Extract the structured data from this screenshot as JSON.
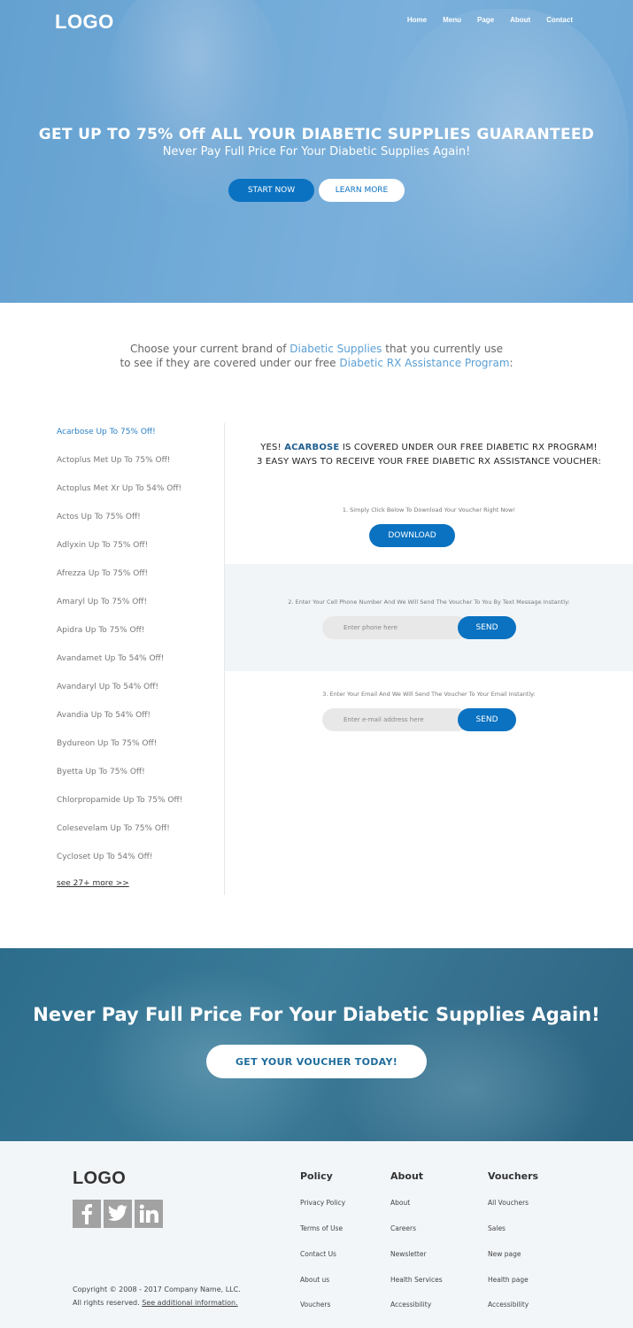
{
  "header": {
    "logo": "LOGO",
    "nav": [
      "Home",
      "Menu",
      "Page",
      "About",
      "Contact"
    ]
  },
  "hero": {
    "title": "GET UP TO 75% Off ALL YOUR DIABETIC SUPPLIES GUARANTEED",
    "subtitle": "Never Pay Full Price For Your Diabetic Supplies Again!",
    "start_label": "START NOW",
    "learn_label": "LEARN MORE"
  },
  "intro": {
    "line1_a": "Choose your current brand of ",
    "line1_hl": "Diabetic Supplies",
    "line1_b": " that you currently use",
    "line2_a": "to see if they are covered under our free ",
    "line2_hl": "Diabetic RX Assistance Program",
    "line2_b": ":"
  },
  "brands": [
    "Acarbose Up To 75% Off!",
    "Actoplus Met Up To 75% Off!",
    "Actoplus Met Xr Up To 54% Off!",
    "Actos Up To 75% Off!",
    "Adlyxin Up To 75% Off!",
    "Afrezza Up To 75% Off!",
    "Amaryl Up To 75% Off!",
    "Apidra Up To 75% Off!",
    "Avandamet Up To 54% Off!",
    "Avandaryl Up To 54% Off!",
    "Avandia Up To 54% Off!",
    "Bydureon Up To 75% Off!",
    "Byetta Up To 75% Off!",
    "Chlorpropamide Up To 75% Off!",
    "Colesevelam Up To 75% Off!",
    "Cycloset Up To 54% Off!"
  ],
  "see_more": "see 27+ more >>",
  "panel": {
    "title1_a": "YES! ",
    "title1_brand": "ACARBOSE",
    "title1_b": " IS COVERED UNDER OUR FREE DIABETIC RX PROGRAM!",
    "title2": "3 EASY WAYS TO RECEIVE YOUR FREE DIABETIC RX ASSISTANCE VOUCHER:",
    "step1": "1. Simply Click Below To Download Your Voucher Right Now!",
    "download_label": "DOWNLOAD",
    "step2": "2. Enter Your Cell Phone Number And We Will Send The Voucher To You By Text Message Instantly:",
    "phone_placeholder": "Enter phone here",
    "step3": "3. Enter Your Email And We Will Send The Voucher To Your Email Instantly:",
    "email_placeholder": "Enter e-mail address here",
    "send_label": "SEND"
  },
  "cta": {
    "title": "Never Pay Full Price For Your Diabetic Supplies Again!",
    "button": "GET YOUR VOUCHER TODAY!"
  },
  "footer": {
    "logo": "LOGO",
    "copyright_line1": "Copyright © 2008 - 2017 Company Name, LLC.",
    "copyright_line2": "All rights reserved. ",
    "copyright_link": "See additional information.",
    "columns": [
      {
        "head": "Policy",
        "links": [
          "Privacy Policy",
          "Terms of Use",
          "Contact Us",
          "About us",
          "Vouchers"
        ]
      },
      {
        "head": "About",
        "links": [
          "About",
          "Careers",
          "Newsletter",
          "Health Services",
          "Accessibility"
        ]
      },
      {
        "head": "Vouchers",
        "links": [
          "All Vouchers",
          "Sales",
          "New page",
          "Health page",
          "Accessibility"
        ]
      }
    ]
  },
  "colors": {
    "accent": "#0a72c1",
    "highlight": "#5a9fd4",
    "hero_bg": "#7fb6dc",
    "cta_bg": "#3a7b98",
    "footer_bg": "#f3f6f9"
  },
  "icons": [
    "facebook-icon",
    "twitter-icon",
    "linkedin-icon"
  ]
}
